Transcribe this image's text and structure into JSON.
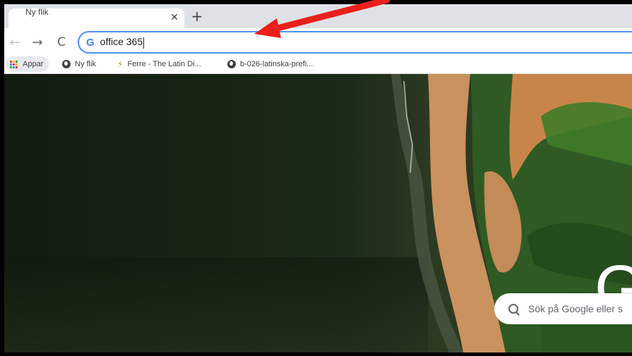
{
  "tab": {
    "title": "Ny flik",
    "close_icon": "close-icon",
    "new_tab_icon": "plus-icon"
  },
  "toolbar": {
    "back_icon": "back-arrow-icon",
    "forward_icon": "forward-arrow-icon",
    "reload_icon": "reload-icon",
    "omnibox_icon": "G",
    "omnibox_value": "office 365"
  },
  "bookmarks": [
    {
      "label": "Appar",
      "icon": "apps-grid-icon"
    },
    {
      "label": "Ny flik",
      "icon": "globe-icon"
    },
    {
      "label": "Ferre - The Latin Di...",
      "icon": "ferre-icon"
    },
    {
      "label": "b-026-latinska-prefi...",
      "icon": "globe-icon"
    }
  ],
  "newtab": {
    "logo_letter": "G",
    "search_placeholder": "Sök på Google eller s"
  },
  "colors": {
    "accent": "#4d90fe",
    "annotation_arrow": "#e8201c"
  }
}
